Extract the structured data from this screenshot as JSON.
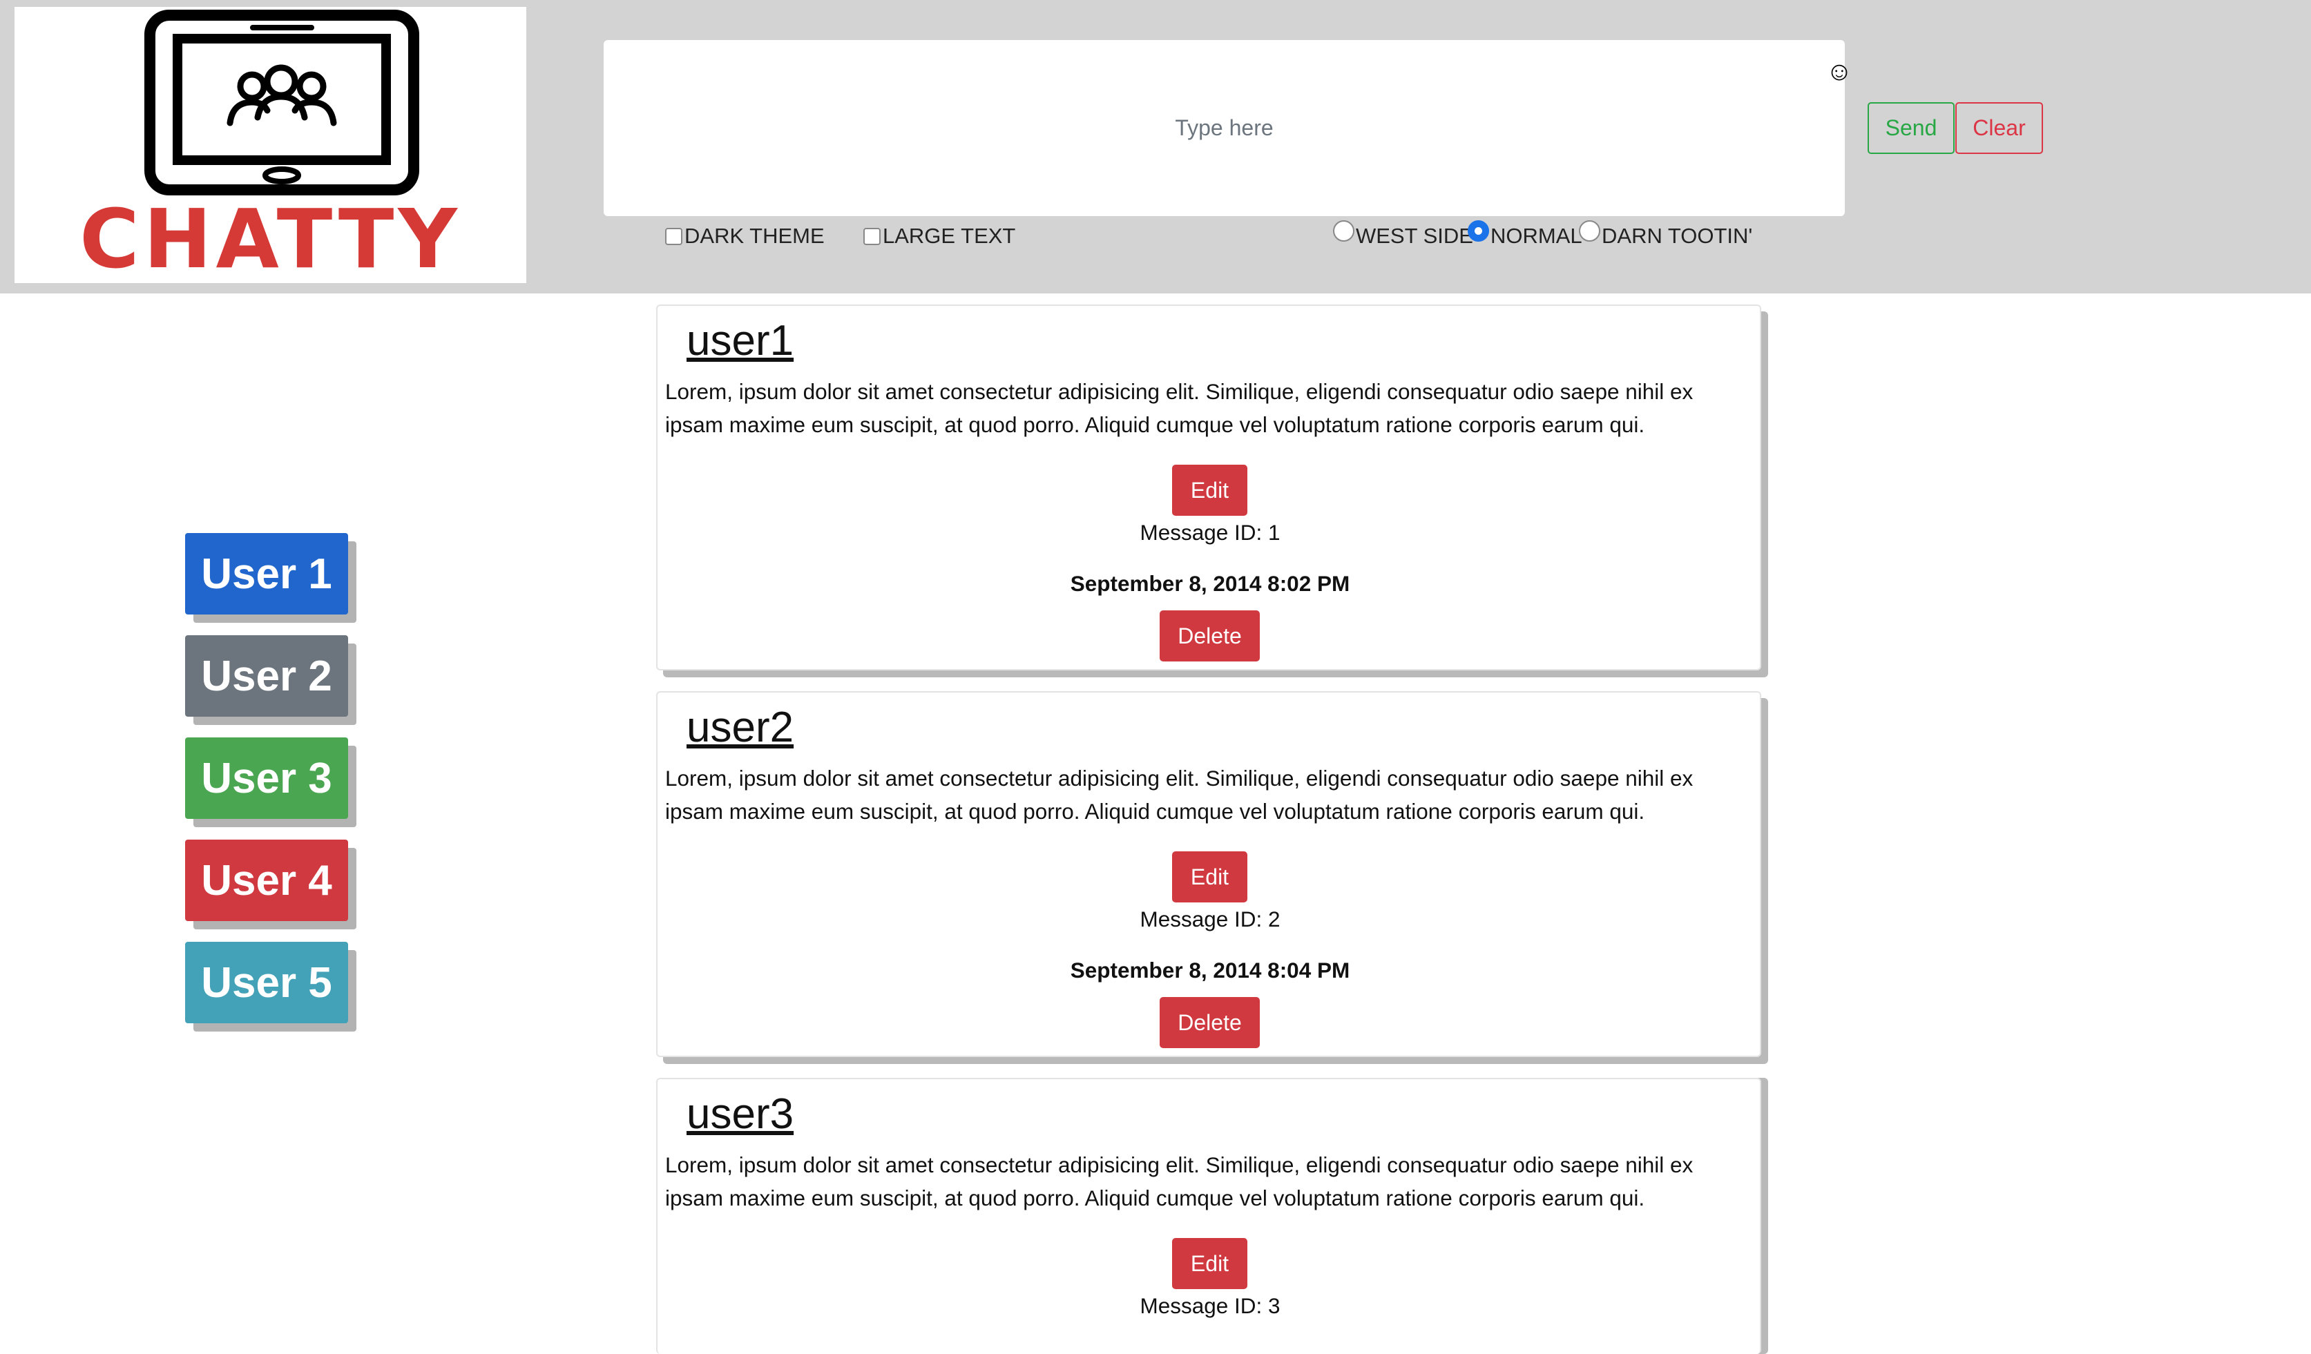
{
  "logo": {
    "text": "CHATTY"
  },
  "composer": {
    "placeholder": "Type here",
    "emoji": "☺",
    "send_label": "Send",
    "clear_label": "Clear"
  },
  "options": {
    "dark_theme_label": "DARK THEME",
    "large_text_label": "LARGE TEXT",
    "dialects": [
      {
        "label": "WEST SIDE",
        "checked": false
      },
      {
        "label": "NORMAL",
        "checked": true
      },
      {
        "label": "DARN TOOTIN'",
        "checked": false
      }
    ]
  },
  "users": [
    {
      "label": "User 1",
      "color": "#2166cc"
    },
    {
      "label": "User 2",
      "color": "#6c757d"
    },
    {
      "label": "User 3",
      "color": "#4aa651"
    },
    {
      "label": "User 4",
      "color": "#d0393f"
    },
    {
      "label": "User 5",
      "color": "#44a2b8"
    }
  ],
  "messages": [
    {
      "user": "user1",
      "text": "Lorem, ipsum dolor sit amet consectetur adipisicing elit. Similique, eligendi consequatur odio saepe nihil ex ipsam maxime eum suscipit, at quod porro. Aliquid cumque vel voluptatum ratione corporis earum qui.",
      "edit_label": "Edit",
      "id_text": "Message ID: 1",
      "date": "September 8, 2014 8:02 PM",
      "delete_label": "Delete"
    },
    {
      "user": "user2",
      "text": "Lorem, ipsum dolor sit amet consectetur adipisicing elit. Similique, eligendi consequatur odio saepe nihil ex ipsam maxime eum suscipit, at quod porro. Aliquid cumque vel voluptatum ratione corporis earum qui.",
      "edit_label": "Edit",
      "id_text": "Message ID: 2",
      "date": "September 8, 2014 8:04 PM",
      "delete_label": "Delete"
    },
    {
      "user": "user3",
      "text": "Lorem, ipsum dolor sit amet consectetur adipisicing elit. Similique, eligendi consequatur odio saepe nihil ex ipsam maxime eum suscipit, at quod porro. Aliquid cumque vel voluptatum ratione corporis earum qui.",
      "edit_label": "Edit",
      "id_text": "Message ID: 3"
    }
  ]
}
